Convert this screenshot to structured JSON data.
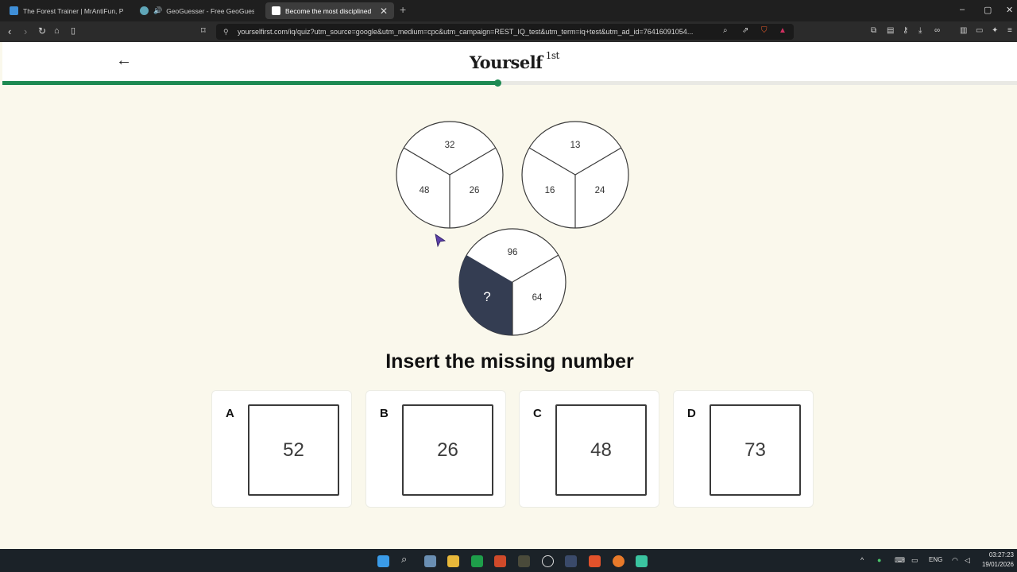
{
  "browser": {
    "tabs": [
      {
        "title": "The Forest Trainer | MrAntiFun, PC Vi",
        "favicon_color": "#3f8fd8"
      },
      {
        "title": "GeoGuesser - Free GeoGuessr Al",
        "favicon_color": "#5fa6b8",
        "sound": "🔊"
      },
      {
        "title": "Become the most disciplined pe",
        "favicon_color": "#ffffff",
        "active": true
      }
    ],
    "new_tab": "+",
    "window_controls": [
      "–",
      "▢",
      "✕"
    ],
    "url": "yourselfirst.com/iq/quiz?utm_source=google&utm_medium=cpc&utm_campaign=REST_IQ_test&utm_term=iq+test&utm_ad_id=76416091054..."
  },
  "header": {
    "back_icon": "←",
    "brand": "Yourself",
    "brand_sup": "1st"
  },
  "progress": {
    "percent": 48.8
  },
  "puzzle": {
    "circles": [
      {
        "top": "32",
        "left": "48",
        "right": "26"
      },
      {
        "top": "13",
        "left": "16",
        "right": "24"
      },
      {
        "top": "96",
        "left": "?",
        "right": "64",
        "highlight_left": true
      }
    ],
    "highlight_color": "#343d52"
  },
  "question": "Insert the missing number",
  "options": [
    {
      "letter": "A",
      "value": "52"
    },
    {
      "letter": "B",
      "value": "26"
    },
    {
      "letter": "C",
      "value": "48"
    },
    {
      "letter": "D",
      "value": "73"
    }
  ],
  "taskbar": {
    "tray": [
      "^",
      "ENG"
    ],
    "time": "03:27:23",
    "date": "19/01/2026"
  }
}
